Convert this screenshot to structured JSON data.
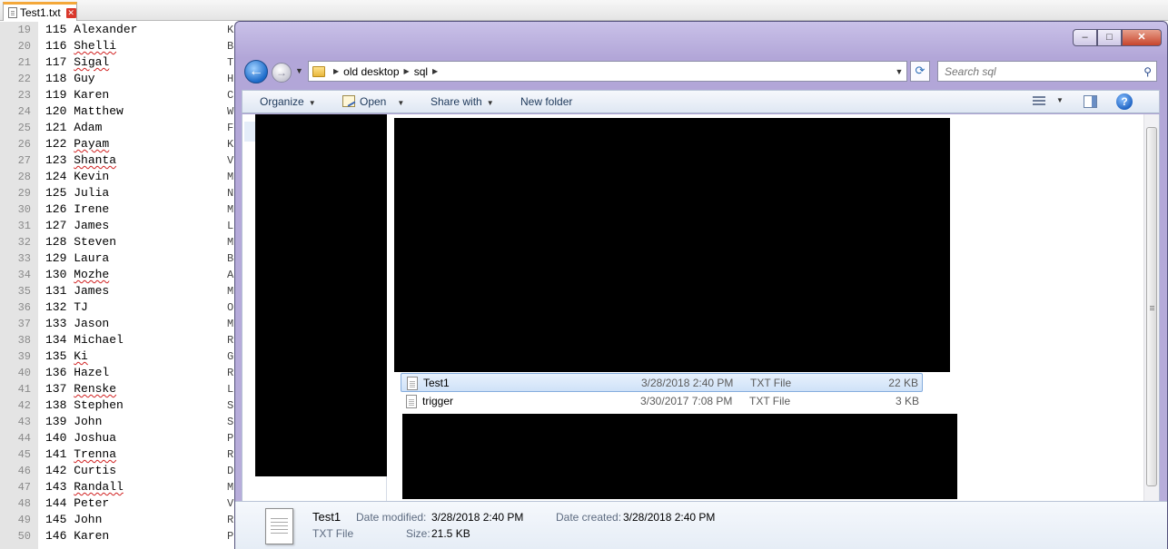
{
  "editor": {
    "tab_label": "Test1.txt",
    "tab_close_glyph": "✕",
    "rows": [
      {
        "ln": "19",
        "text": "115 Alexander",
        "misspelled": false
      },
      {
        "ln": "20",
        "text": "116 Shelli",
        "misspelled": true
      },
      {
        "ln": "21",
        "text": "117 Sigal",
        "misspelled": true
      },
      {
        "ln": "22",
        "text": "118 Guy",
        "misspelled": false
      },
      {
        "ln": "23",
        "text": "119 Karen",
        "misspelled": false
      },
      {
        "ln": "24",
        "text": "120 Matthew",
        "misspelled": false
      },
      {
        "ln": "25",
        "text": "121 Adam",
        "misspelled": false
      },
      {
        "ln": "26",
        "text": "122 Payam",
        "misspelled": true
      },
      {
        "ln": "27",
        "text": "123 Shanta",
        "misspelled": true
      },
      {
        "ln": "28",
        "text": "124 Kevin",
        "misspelled": false
      },
      {
        "ln": "29",
        "text": "125 Julia",
        "misspelled": false
      },
      {
        "ln": "30",
        "text": "126 Irene",
        "misspelled": false
      },
      {
        "ln": "31",
        "text": "127 James",
        "misspelled": false
      },
      {
        "ln": "32",
        "text": "128 Steven",
        "misspelled": false
      },
      {
        "ln": "33",
        "text": "129 Laura",
        "misspelled": false
      },
      {
        "ln": "34",
        "text": "130 Mozhe",
        "misspelled": true
      },
      {
        "ln": "35",
        "text": "131 James",
        "misspelled": false
      },
      {
        "ln": "36",
        "text": "132 TJ",
        "misspelled": false
      },
      {
        "ln": "37",
        "text": "133 Jason",
        "misspelled": false
      },
      {
        "ln": "38",
        "text": "134 Michael",
        "misspelled": false
      },
      {
        "ln": "39",
        "text": "135 Ki",
        "misspelled": true
      },
      {
        "ln": "40",
        "text": "136 Hazel",
        "misspelled": false
      },
      {
        "ln": "41",
        "text": "137 Renske",
        "misspelled": true
      },
      {
        "ln": "42",
        "text": "138 Stephen",
        "misspelled": false
      },
      {
        "ln": "43",
        "text": "139 John",
        "misspelled": false
      },
      {
        "ln": "44",
        "text": "140 Joshua",
        "misspelled": false
      },
      {
        "ln": "45",
        "text": "141 Trenna",
        "misspelled": true
      },
      {
        "ln": "46",
        "text": "142 Curtis",
        "misspelled": false
      },
      {
        "ln": "47",
        "text": "143 Randall",
        "misspelled": true
      },
      {
        "ln": "48",
        "text": "144 Peter",
        "misspelled": false
      },
      {
        "ln": "49",
        "text": "145 John",
        "misspelled": false
      },
      {
        "ln": "50",
        "text": "146 Karen",
        "misspelled": false
      }
    ],
    "col2_chars": [
      "K",
      "B",
      "T",
      "H",
      "C",
      "W",
      "F",
      "K",
      "V",
      "M",
      "N",
      "M",
      "L",
      "M",
      "B",
      "A",
      "M",
      "O",
      "M",
      "R",
      "G",
      "R",
      "L",
      "S",
      "S",
      "P",
      "R",
      "D",
      "M",
      "V",
      "R",
      "P"
    ]
  },
  "explorer": {
    "controls": {
      "minimize": "–",
      "maximize": "□",
      "close": "✕"
    },
    "nav": {
      "back_glyph": "←",
      "forward_glyph": "→",
      "recent_glyph": "▼",
      "refresh_glyph": "⟳"
    },
    "breadcrumb": [
      "old desktop",
      "sql"
    ],
    "breadcrumb_sep": "▶",
    "address_dropdown_glyph": "▼",
    "search": {
      "placeholder": "Search sql",
      "icon_glyph": "⚲"
    },
    "toolbar": {
      "organize": "Organize",
      "open": "Open",
      "share_with": "Share with",
      "new_folder": "New folder",
      "arrow": "▼",
      "help_glyph": "?"
    },
    "files": [
      {
        "name": "Test1",
        "date": "3/28/2018 2:40 PM",
        "type": "TXT File",
        "size": "22 KB",
        "selected": true
      },
      {
        "name": "trigger",
        "date": "3/30/2017 7:08 PM",
        "type": "TXT File",
        "size": "3 KB",
        "selected": false
      }
    ],
    "details": {
      "name": "Test1",
      "type": "TXT File",
      "modified_label": "Date modified:",
      "modified": "3/28/2018 2:40 PM",
      "created_label": "Date created:",
      "created": "3/28/2018 2:40 PM",
      "size_label": "Size:",
      "size": "21.5 KB"
    }
  }
}
